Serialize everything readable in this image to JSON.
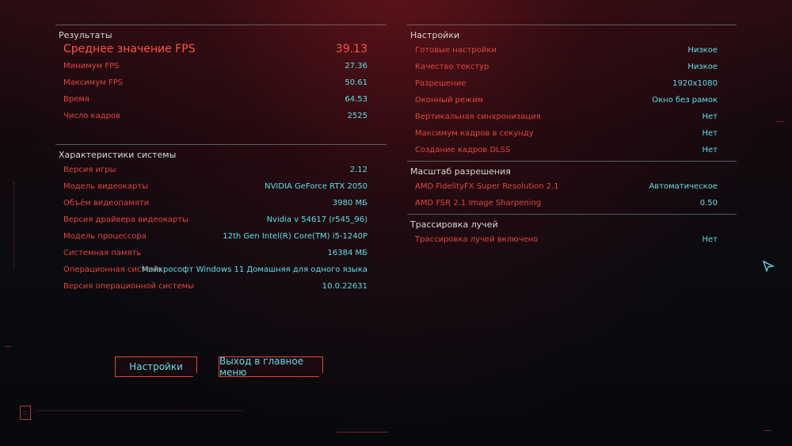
{
  "results": {
    "title": "Результаты",
    "rows": [
      {
        "label": "Среднее значение FPS",
        "value": "39.13"
      },
      {
        "label": "Минимум FPS",
        "value": "27.36"
      },
      {
        "label": "Максимум FPS",
        "value": "50.61"
      },
      {
        "label": "Время",
        "value": "64.53"
      },
      {
        "label": "Число кадров",
        "value": "2525"
      }
    ]
  },
  "system": {
    "title": "Характеристики системы",
    "rows": [
      {
        "label": "Версия игры",
        "value": "2.12"
      },
      {
        "label": "Модель видеокарты",
        "value": "NVIDIA GeForce RTX 2050"
      },
      {
        "label": "Объём видеопамяти",
        "value": "3980 МБ"
      },
      {
        "label": "Версия драйвера видеокарты",
        "value": "Nvidia v 54617 (r545_96)"
      },
      {
        "label": "Модель процессора",
        "value": "12th Gen Intel(R) Core(TM) i5-1240P"
      },
      {
        "label": "Системная память",
        "value": "16384 МБ"
      },
      {
        "label": "Операционная система",
        "value": "Майкрософт Windows 11 Домашняя для одного языка"
      },
      {
        "label": "Версия операционной системы",
        "value": "10.0.22631"
      }
    ]
  },
  "settings": {
    "title": "Настройки",
    "rows": [
      {
        "label": "Готовые настройки",
        "value": "Низкое"
      },
      {
        "label": "Качество текстур",
        "value": "Низкое"
      },
      {
        "label": "Разрешение",
        "value": "1920x1080"
      },
      {
        "label": "Оконный режим",
        "value": "Окно без рамок"
      },
      {
        "label": "Вертикальная синхронизация",
        "value": "Нет"
      },
      {
        "label": "Максимум кадров в секунду",
        "value": "Нет"
      },
      {
        "label": "Создание кадров DLSS",
        "value": "Нет"
      }
    ]
  },
  "scaling": {
    "title": "Масштаб разрешения",
    "rows": [
      {
        "label": "AMD FidelityFX Super Resolution 2.1",
        "value": "Автоматическое"
      },
      {
        "label": "AMD FSR 2.1 Image Sharpening",
        "value": "0.50"
      }
    ]
  },
  "raytracing": {
    "title": "Трассировка лучей",
    "rows": [
      {
        "label": "Трассировка лучей включено",
        "value": "Нет"
      }
    ]
  },
  "buttons": {
    "settings_label": "Настройки",
    "exit_label": "Выход в главное меню"
  },
  "colors": {
    "accent_red": "#e2463f",
    "value_cyan": "#5fe0e6"
  }
}
